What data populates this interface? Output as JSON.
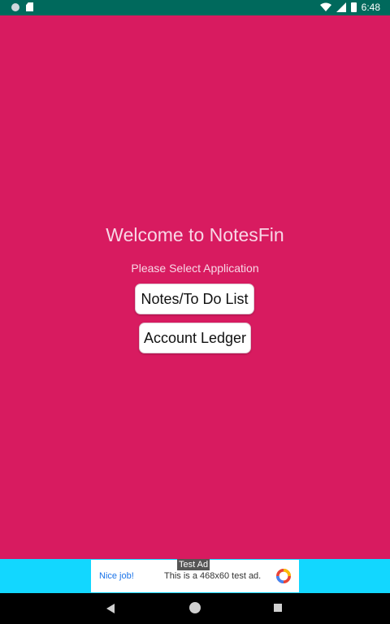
{
  "status_bar": {
    "time": "6:48",
    "icons": [
      "notification-dot-icon",
      "sd-card-icon",
      "wifi-icon",
      "cellular-signal-icon",
      "battery-icon"
    ]
  },
  "main": {
    "title": "Welcome to NotesFin",
    "subtitle": "Please Select Application",
    "buttons": {
      "notes": "Notes/To Do List",
      "ledger": "Account Ledger"
    }
  },
  "ad": {
    "tag": "Test Ad",
    "nice": "Nice job!",
    "text": "This is a 468x60 test ad."
  },
  "nav_bar": {
    "icons": [
      "back-icon",
      "home-icon",
      "recents-icon"
    ]
  },
  "colors": {
    "background": "#D81B60",
    "status_bar": "#00695C",
    "ad_strip": "#12D7FF",
    "nav_bar": "#000000",
    "button": "#FFFFFF"
  }
}
